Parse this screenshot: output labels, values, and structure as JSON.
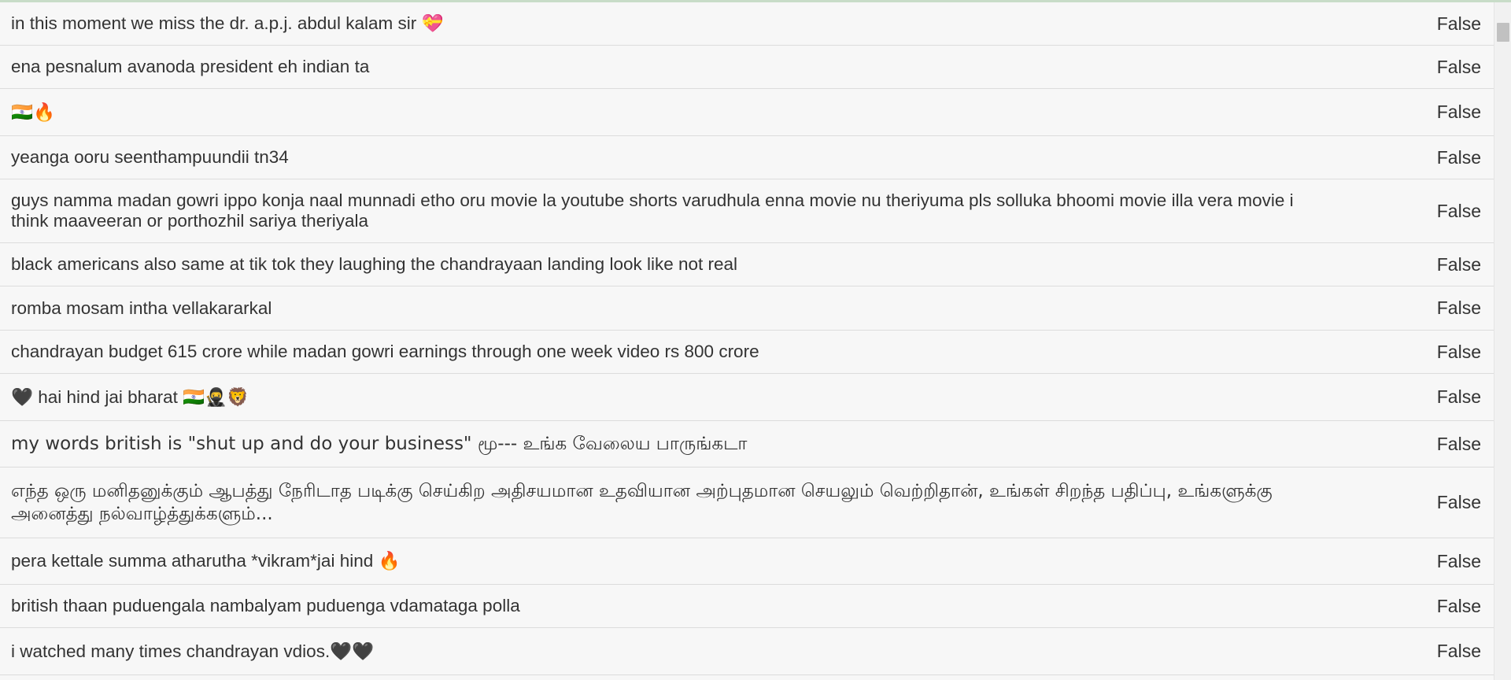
{
  "rows": [
    {
      "text": "in this moment we miss the dr. a.p.j. abdul kalam sir 💝",
      "value": "False"
    },
    {
      "text": "ena pesnalum avanoda president eh indian ta",
      "value": "False"
    },
    {
      "text": "🇮🇳🔥",
      "value": "False"
    },
    {
      "text": "yeanga ooru seenthampuundii tn34",
      "value": "False"
    },
    {
      "text": "guys namma madan gowri ippo konja naal munnadi etho oru movie la youtube shorts varudhula enna movie nu theriyuma pls solluka bhoomi movie illa vera movie i think maaveeran or porthozhil sariya theriyala",
      "value": "False"
    },
    {
      "text": "black americans also same at tik tok they laughing the chandrayaan landing look like not real",
      "value": "False"
    },
    {
      "text": "romba mosam intha vellakararkal",
      "value": "False"
    },
    {
      "text": "chandrayan budget 615 crore while madan gowri earnings through one week video rs 800 crore",
      "value": "False"
    },
    {
      "text": "🖤 hai hind jai bharat 🇮🇳🥷🦁",
      "value": "False"
    },
    {
      "text": "my words british is \"shut up and do your business\" மூ--- உங்க வேலைய பாருங்கடா",
      "value": "False"
    },
    {
      "text": "எந்த ஒரு மனிதனுக்கும் ஆபத்து நேரிடாத படிக்கு செய்கிற அதிசயமான உதவியான அற்புதமான செயலும் வெற்றிதான், உங்கள் சிறந்த பதிப்பு, உங்களுக்கு அனைத்து நல்வாழ்த்துக்களும்...",
      "value": "False"
    },
    {
      "text": "pera kettale summa atharutha *vikram*jai hind 🔥",
      "value": "False"
    },
    {
      "text": "british thaan puduengala nambalyam puduenga vdamataga polla",
      "value": "False"
    },
    {
      "text": "i watched many times chandrayan vdios.🖤🖤",
      "value": "False"
    }
  ]
}
